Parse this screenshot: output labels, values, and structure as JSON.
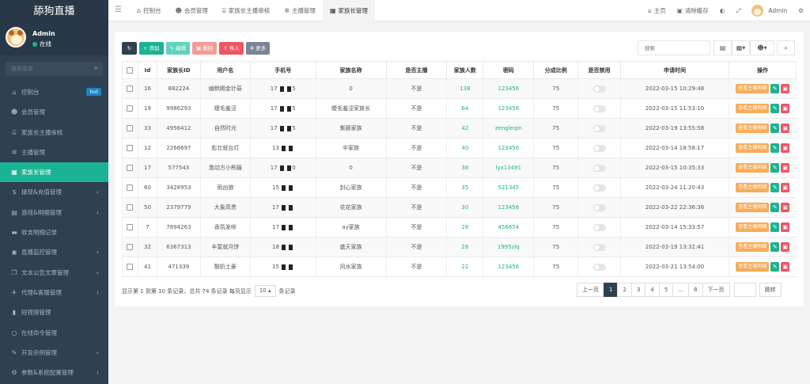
{
  "app": {
    "title": "舔狗直播"
  },
  "profile": {
    "name": "Admin",
    "status": "在线"
  },
  "sidebar": {
    "search_placeholder": "搜索菜单",
    "items": [
      {
        "label": "控制台",
        "icon": "dashboard-icon",
        "glyph": "⌂",
        "badge": "hot"
      },
      {
        "label": "会员管理",
        "icon": "user-icon",
        "glyph": "☻"
      },
      {
        "label": "家族长主播审核",
        "icon": "bank-icon",
        "glyph": "⌸"
      },
      {
        "label": "主播管理",
        "icon": "gear-icon",
        "glyph": "✲"
      },
      {
        "label": "家族长管理",
        "icon": "calculator-icon",
        "glyph": "▦",
        "active": true
      },
      {
        "label": "提现&充值管理",
        "icon": "dollar-icon",
        "glyph": "$",
        "arrow": true
      },
      {
        "label": "游戏&明细管理",
        "icon": "list-icon",
        "glyph": "▤",
        "arrow": true
      },
      {
        "label": "收支明细记录",
        "icon": "bed-icon",
        "glyph": "▬"
      },
      {
        "label": "直播监控管理",
        "icon": "video-icon",
        "glyph": "◉",
        "arrow": true
      },
      {
        "label": "文本公告文章管理",
        "icon": "copy-icon",
        "glyph": "❐",
        "arrow": true
      },
      {
        "label": "代理&客服管理",
        "icon": "plane-icon",
        "glyph": "✈",
        "arrow": true
      },
      {
        "label": "短视频管理",
        "icon": "film-icon",
        "glyph": "▮"
      },
      {
        "label": "在线命令管理",
        "icon": "circle-icon",
        "glyph": "○"
      },
      {
        "label": "开发示例管理",
        "icon": "wrench-icon",
        "glyph": "✎",
        "arrow": true
      },
      {
        "label": "参数&系统配置管理",
        "icon": "cogs-icon",
        "glyph": "⚙",
        "arrow": true
      }
    ]
  },
  "topbar": {
    "tabs": [
      {
        "label": "控制台",
        "icon": "dashboard-icon",
        "glyph": "⌂"
      },
      {
        "label": "会员管理",
        "icon": "user-icon",
        "glyph": "☻"
      },
      {
        "label": "家族长主播审核",
        "icon": "bank-icon",
        "glyph": "⌸"
      },
      {
        "label": "主播管理",
        "icon": "gear-icon",
        "glyph": "✲"
      },
      {
        "label": "家族长管理",
        "icon": "calculator-icon",
        "glyph": "▦",
        "active": true
      }
    ],
    "home": "主页",
    "clear_cache": "清除缓存",
    "user": "Admin"
  },
  "toolbar": {
    "add": "添加",
    "edit": "编辑",
    "delete": "删除",
    "import": "导入",
    "more": "更多",
    "search_placeholder": "搜索"
  },
  "table": {
    "headers": [
      "Id",
      "家族长ID",
      "用户名",
      "手机号",
      "家族名称",
      "是否主播",
      "家族人数",
      "密码",
      "分成比例",
      "是否禁用",
      "申请时间",
      "操作"
    ],
    "view_label": "查看主播明细",
    "rows": [
      {
        "id": "16",
        "fid": "882224",
        "user": "幽默踢金针菇",
        "p1": "17",
        "p2": "5",
        "family": "0",
        "anchor": "不是",
        "count": "138",
        "pwd": "123456",
        "ratio": "75",
        "time": "2022-03-15 10:29:48"
      },
      {
        "id": "19",
        "fid": "9986293",
        "user": "睫毛羞涩",
        "p1": "17",
        "p2": "5",
        "family": "睫毛羞涩家族长",
        "anchor": "不是",
        "count": "64",
        "pwd": "123456",
        "ratio": "75",
        "time": "2022-03-15 11:53:10"
      },
      {
        "id": "33",
        "fid": "4956412",
        "user": "自然时光",
        "p1": "17",
        "p2": "5",
        "family": "紫藤家族",
        "anchor": "不是",
        "count": "42",
        "pwd": "zengleqin",
        "ratio": "75",
        "time": "2022-03-19 13:55:58"
      },
      {
        "id": "12",
        "fid": "2266697",
        "user": "彪壮就台灯",
        "p1": "13",
        "p2": "",
        "family": "伞家族",
        "anchor": "不是",
        "count": "40",
        "pwd": "123456",
        "ratio": "75",
        "time": "2022-03-14 18:58:17"
      },
      {
        "id": "17",
        "fid": "577543",
        "user": "激动方小熊猫",
        "p1": "17",
        "p2": "0",
        "family": "0",
        "anchor": "不是",
        "count": "38",
        "pwd": "lyx13491",
        "ratio": "75",
        "time": "2022-03-15 10:35:33"
      },
      {
        "id": "60",
        "fid": "3428953",
        "user": "雨凶狼",
        "p1": "15",
        "p2": "",
        "family": "封心家族",
        "anchor": "不是",
        "count": "35",
        "pwd": "521345",
        "ratio": "75",
        "time": "2022-03-24 11:20:43"
      },
      {
        "id": "50",
        "fid": "2379779",
        "user": "大象高贵",
        "p1": "17",
        "p2": "",
        "family": "花花家族",
        "anchor": "不是",
        "count": "30",
        "pwd": "123456",
        "ratio": "75",
        "time": "2022-03-22 22:36:36"
      },
      {
        "id": "7",
        "fid": "7894263",
        "user": "香氛发嗲",
        "p1": "17",
        "p2": "",
        "family": "ay家族",
        "anchor": "不是",
        "count": "28",
        "pwd": "456654",
        "ratio": "75",
        "time": "2022-03-14 15:33:57"
      },
      {
        "id": "32",
        "fid": "6367313",
        "user": "丰富就月饼",
        "p1": "18",
        "p2": "",
        "family": "盛天家族",
        "anchor": "不是",
        "count": "28",
        "pwd": "1995zlq",
        "ratio": "75",
        "time": "2022-03-19 13:32:41"
      },
      {
        "id": "41",
        "fid": "471339",
        "user": "酸奶土豪",
        "p1": "15",
        "p2": "",
        "family": "风水家族",
        "anchor": "不是",
        "count": "22",
        "pwd": "123456",
        "ratio": "75",
        "time": "2022-03-21 13:54:00"
      }
    ]
  },
  "footer": {
    "info_prefix": "显示第 1 到第 10 条记录，总共 74 条记录 每页显示",
    "page_size": "10",
    "info_suffix": "条记录"
  },
  "pagination": {
    "prev": "上一页",
    "pages": [
      "1",
      "2",
      "3",
      "4",
      "5",
      "...",
      "8"
    ],
    "next": "下一页",
    "go": "跳转"
  },
  "colors": {
    "sidebar": "#2f4050",
    "accent": "#1ab394",
    "danger": "#ed5565",
    "warning": "#f8ac59"
  }
}
